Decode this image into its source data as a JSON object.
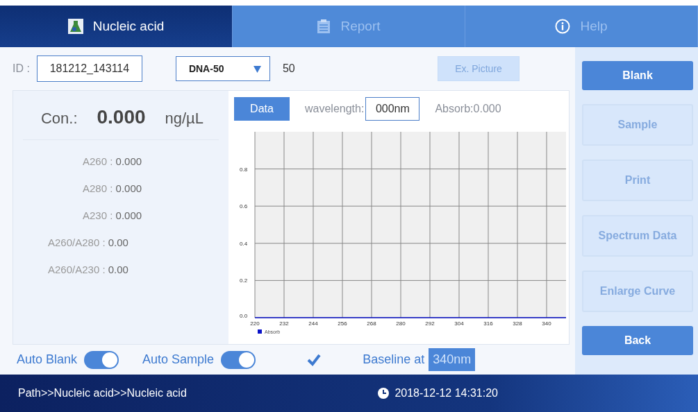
{
  "tabs": [
    {
      "label": "Nucleic acid",
      "selected": true
    },
    {
      "label": "Report",
      "selected": false
    },
    {
      "label": "Help",
      "selected": false
    }
  ],
  "toolbar": {
    "id_label": "ID :",
    "id_value": "181212_143114",
    "dropdown": "DNA-50",
    "factor": "50",
    "ex_picture": {
      "label": "Ex. Picture",
      "disabled": true
    }
  },
  "concentration": {
    "label": "Con.:",
    "value": "0.000",
    "unit": "ng/µL"
  },
  "readings": [
    {
      "label": "A260 : ",
      "value": "0.000"
    },
    {
      "label": "A280 : ",
      "value": "0.000"
    },
    {
      "label": "A230 : ",
      "value": "0.000"
    },
    {
      "label": "A260/A280 : ",
      "value": "0.00"
    },
    {
      "label": "A260/A230 : ",
      "value": "0.00"
    }
  ],
  "chart_header": {
    "data_button": "Data",
    "wavelength_label": "wavelength:",
    "wavelength_value": "000nm",
    "absorb": "Absorb:0.000"
  },
  "chart_data": {
    "type": "line",
    "grid": true,
    "x": [
      220,
      348
    ],
    "xlim": [
      220,
      348
    ],
    "ylim": [
      0,
      1
    ],
    "xticks": [
      220,
      232,
      244,
      256,
      268,
      280,
      292,
      304,
      316,
      328,
      340
    ],
    "yticks": [
      {
        "value": 0,
        "label": "0.0"
      },
      {
        "value": 0.2,
        "label": "0.2"
      },
      {
        "value": 0.4,
        "label": "0.4"
      },
      {
        "value": 0.6,
        "label": "0.6"
      },
      {
        "value": 0.8,
        "label": "0.8"
      }
    ],
    "series": [
      {
        "name": "Absorb",
        "color": "#0a12c8",
        "values": [
          0,
          0
        ]
      }
    ]
  },
  "options": [
    {
      "kind": "switch",
      "label": "Auto Blank",
      "on": true
    },
    {
      "kind": "switch",
      "label": "Auto Sample",
      "on": true
    },
    {
      "kind": "checkbox",
      "checked": true
    },
    {
      "kind": "baseline",
      "label": "Baseline at",
      "value": "340nm"
    }
  ],
  "sidebar": [
    {
      "label": "Blank",
      "disabled": false
    },
    {
      "label": "Sample",
      "disabled": true
    },
    {
      "label": "Print",
      "disabled": true
    },
    {
      "label": "Spectrum Data",
      "disabled": true
    },
    {
      "label": "Enlarge Curve",
      "disabled": true
    },
    {
      "label": "Back",
      "disabled": false
    }
  ],
  "status_bar": {
    "path": "Path>>Nucleic acid>>Nucleic acid",
    "datetime": "2018-12-12 14:31:20"
  }
}
